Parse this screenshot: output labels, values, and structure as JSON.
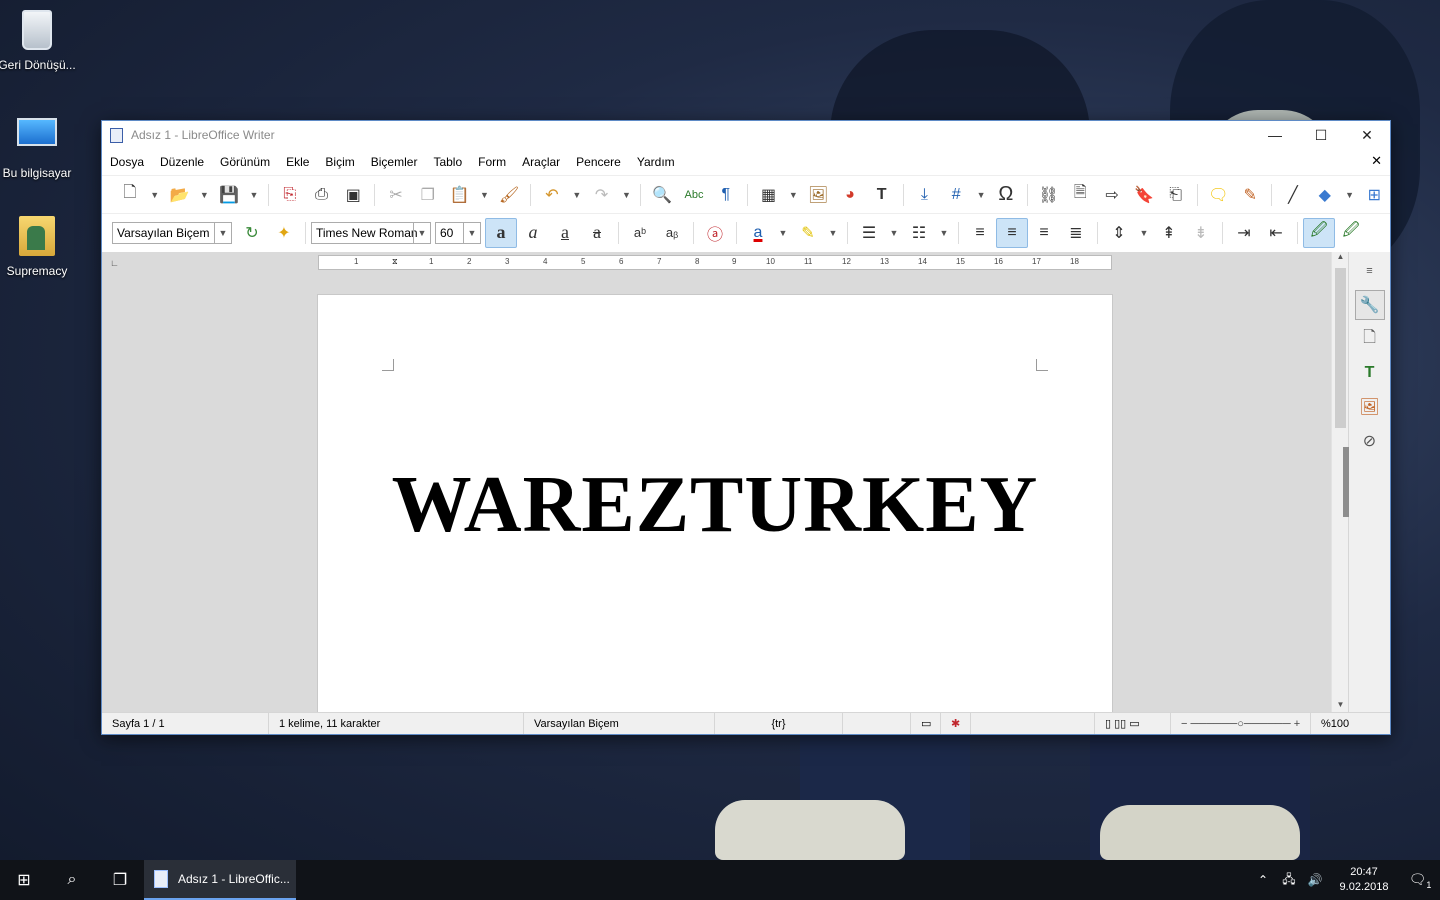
{
  "desktop": {
    "icons": [
      {
        "label": "Geri Dönüşü...",
        "icon": "recycle-bin-icon"
      },
      {
        "label": "Bu bilgisayar",
        "icon": "computer-icon"
      },
      {
        "label": "Supremacy",
        "icon": "folder-icon"
      }
    ]
  },
  "window": {
    "title": "Adsız 1 - LibreOffice Writer",
    "controls": {
      "minimize": "—",
      "maximize": "☐",
      "close": "✕"
    }
  },
  "menubar": {
    "items": [
      "Dosya",
      "Düzenle",
      "Görünüm",
      "Ekle",
      "Biçim",
      "Biçemler",
      "Tablo",
      "Form",
      "Araçlar",
      "Pencere",
      "Yardım"
    ],
    "close_doc": "✕"
  },
  "formatting": {
    "paragraph_style": "Varsayılan Biçem",
    "font_name": "Times New Roman",
    "font_size": "60"
  },
  "ruler": {
    "numbers": [
      "1",
      "1",
      "2",
      "3",
      "4",
      "5",
      "6",
      "7",
      "8",
      "9",
      "10",
      "11",
      "12",
      "13",
      "14",
      "15",
      "16",
      "17",
      "18"
    ]
  },
  "document": {
    "text": "WAREZTURKEY"
  },
  "statusbar": {
    "page": "Sayfa 1 / 1",
    "words": "1 kelime, 11 karakter",
    "style": "Varsayılan Biçem",
    "language": "{tr}",
    "zoom": "%100"
  },
  "taskbar": {
    "app_label": "Adsız 1 - LibreOffic...",
    "time": "20:47",
    "date": "9.02.2018",
    "notification_count": "1"
  }
}
